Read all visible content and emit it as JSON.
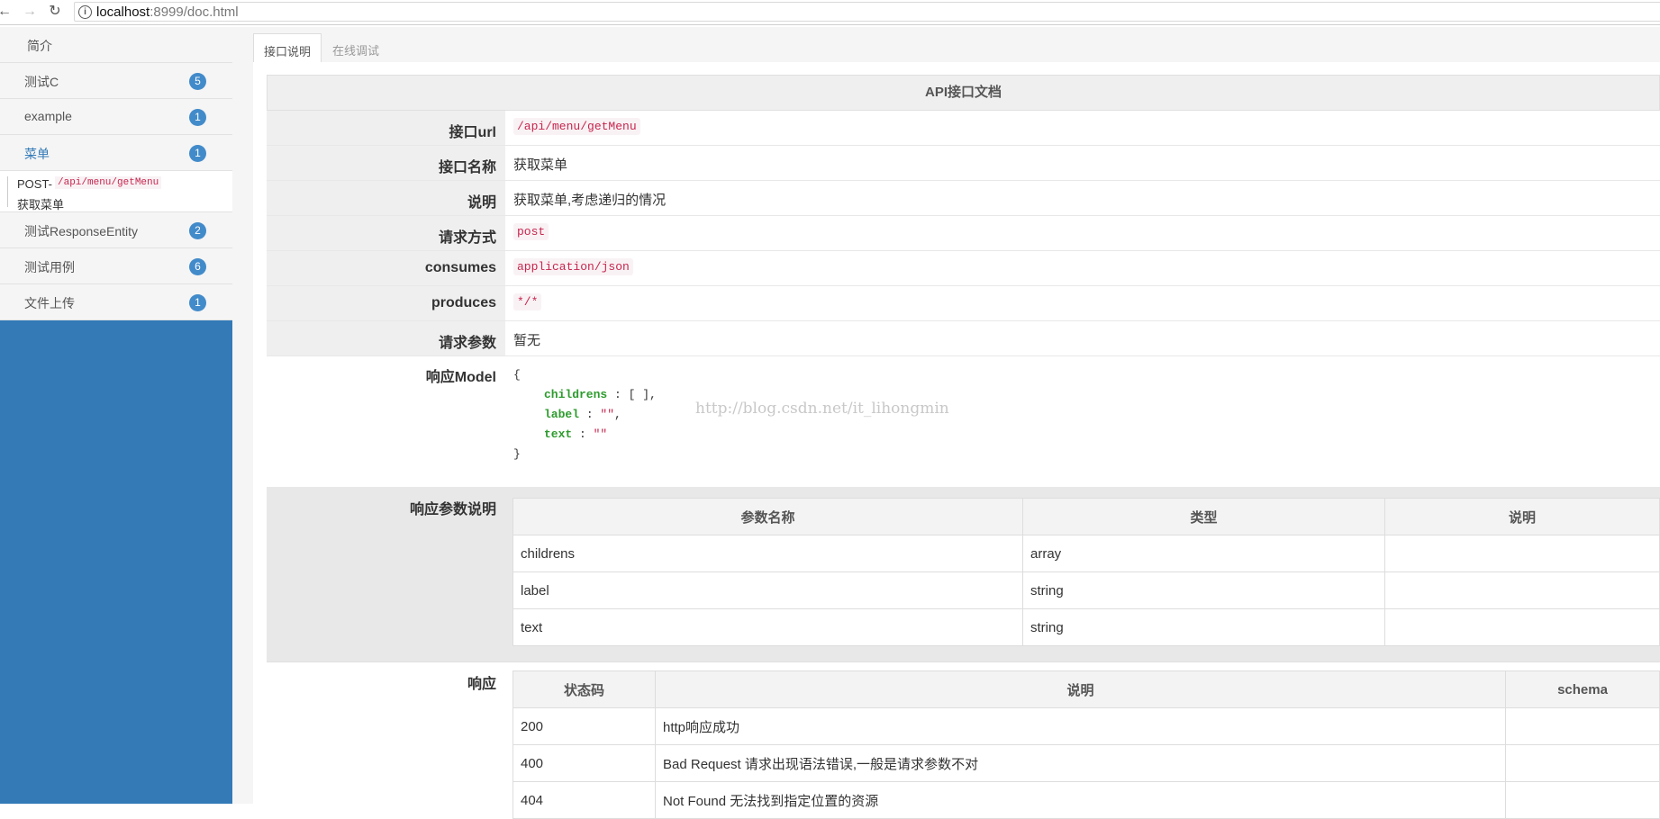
{
  "browser": {
    "url_host": "localhost",
    "url_rest": ":8999/doc.html",
    "back_icon": "←",
    "forward_icon": "→",
    "reload_icon": "↻",
    "info_icon": "i"
  },
  "sidebar": {
    "intro": "简介",
    "items": [
      {
        "label": "测试C",
        "count": "5"
      },
      {
        "label": "example",
        "count": "1"
      },
      {
        "label": "菜单",
        "count": "1"
      }
    ],
    "sub_item": {
      "method": "POST-",
      "path": "/api/menu/getMenu",
      "name": "获取菜单"
    },
    "items_after": [
      {
        "label": "测试ResponseEntity",
        "count": "2"
      },
      {
        "label": "测试用例",
        "count": "6"
      },
      {
        "label": "文件上传",
        "count": "1"
      }
    ],
    "accent_color": "#337ab7"
  },
  "tabs": [
    {
      "label": "接口说明",
      "active": true
    },
    {
      "label": "在线调试",
      "active": false
    }
  ],
  "doc": {
    "title": "API接口文档",
    "url_key": "接口url",
    "url_val": "/api/menu/getMenu",
    "name_key": "接口名称",
    "name_val": "获取菜单",
    "desc_key": "说明",
    "desc_val": "获取菜单,考虑递归的情况",
    "method_key": "请求方式",
    "method_val": "post",
    "consumes_key": "consumes",
    "consumes_val": "application/json",
    "produces_key": "produces",
    "produces_val": "*/*",
    "params_key": "请求参数",
    "params_val": "暂无",
    "model_key": "响应Model",
    "model": {
      "open": "{",
      "lines": [
        {
          "key": "childrens",
          "sep": " : [ ],",
          "val": ""
        },
        {
          "key": "label",
          "sep": " : ",
          "val": "\"\"",
          "tail": ","
        },
        {
          "key": "text",
          "sep": " : ",
          "val": "\"\"",
          "tail": ""
        }
      ],
      "close": "}"
    },
    "watermark": "http://blog.csdn.net/it_lihongmin",
    "resp_params_key": "响应参数说明",
    "resp_params_headers": [
      "参数名称",
      "类型",
      "说明"
    ],
    "resp_params_rows": [
      [
        "childrens",
        "array",
        ""
      ],
      [
        "label",
        "string",
        ""
      ],
      [
        "text",
        "string",
        ""
      ]
    ],
    "resp_key": "响应",
    "resp_headers": [
      "状态码",
      "说明",
      "schema"
    ],
    "resp_rows": [
      [
        "200",
        "http响应成功",
        ""
      ],
      [
        "400",
        "Bad Request 请求出现语法错误,一般是请求参数不对",
        ""
      ],
      [
        "404",
        "Not Found 无法找到指定位置的资源",
        ""
      ]
    ]
  }
}
